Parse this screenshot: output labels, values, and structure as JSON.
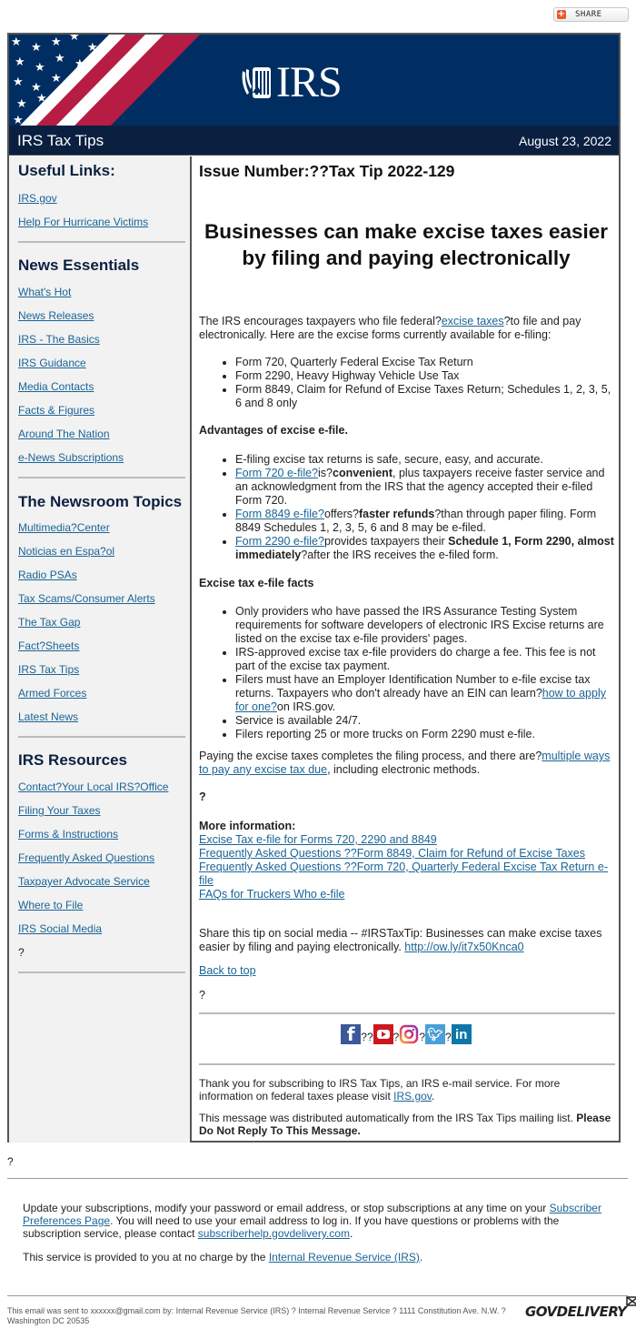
{
  "share": {
    "label": "SHARE"
  },
  "header": {
    "logo_text": "IRS",
    "title": "IRS Tax Tips",
    "date": "August 23, 2022"
  },
  "colors": {
    "banner": "#002e62",
    "titlebar": "#0b2040",
    "link": "#1a6496",
    "flag_red": "#b71c45"
  },
  "sidebar": {
    "sections": [
      {
        "heading": "Useful Links:",
        "links": [
          "IRS.gov",
          "Help For Hurricane Victims"
        ]
      },
      {
        "heading": "News Essentials",
        "links": [
          "What's Hot",
          "News Releases",
          "IRS - The Basics",
          "IRS Guidance",
          "Media Contacts",
          "Facts & Figures",
          "Around The Nation",
          "e-News Subscriptions"
        ]
      },
      {
        "heading": "The Newsroom Topics",
        "links": [
          "Multimedia?Center",
          "Noticias en Espa?ol",
          "Radio PSAs",
          "Tax Scams/Consumer Alerts",
          "The Tax Gap",
          "Fact?Sheets",
          "IRS Tax Tips",
          "Armed Forces",
          "Latest News"
        ]
      },
      {
        "heading": "IRS Resources",
        "links": [
          "Contact?Your Local IRS?Office",
          "Filing Your Taxes",
          "Forms & Instructions",
          "Frequently Asked Questions",
          "Taxpayer Advocate Service",
          "Where to File",
          "IRS Social Media"
        ],
        "trailing": "?"
      }
    ]
  },
  "main": {
    "issue": "Issue Number:??Tax Tip 2022-129",
    "headline": "Businesses can make excise taxes easier by filing and paying electronically",
    "intro": {
      "before": "The IRS encourages taxpayers who file federal?",
      "link": "excise taxes",
      "after": "?to file and pay electronically. Here are the excise forms currently available for e-filing:"
    },
    "forms": [
      "Form 720, Quarterly Federal Excise Tax Return",
      "Form 2290, Heavy Highway Vehicle Use Tax",
      "Form 8849, Claim for Refund of Excise Taxes Return; Schedules 1, 2, 3, 5, 6 and 8 only"
    ],
    "advantages_heading": "Advantages of excise e-file.",
    "advantages": {
      "a0": "E-filing excise tax returns is safe, secure, easy, and accurate.",
      "a1": {
        "link": "Form 720 e-file?",
        "t1": "is?",
        "bold": "convenient",
        "t2": ", plus taxpayers receive faster service and an acknowledgment from the IRS that the agency accepted their e-filed Form 720."
      },
      "a2": {
        "link": "Form 8849 e-file?",
        "t1": "offers?",
        "bold": "faster refunds",
        "t2": "?than through paper filing. Form 8849 Schedules 1, 2, 3, 5, 6 and 8 may be e-filed."
      },
      "a3": {
        "link": "Form 2290 e-file?",
        "t1": "provides taxpayers their ",
        "bold": "Schedule 1, Form 2290, almost immediately",
        "t2": "?after the IRS receives the e-filed form."
      }
    },
    "facts_heading": "Excise tax e-file facts",
    "facts": {
      "f0": "Only providers who have passed the IRS Assurance Testing System requirements for software developers of electronic IRS Excise returns are listed on the excise tax e-file providers' pages.",
      "f1": "IRS-approved excise tax e-file providers do charge a fee. This fee is not part of the excise tax payment.",
      "f2": {
        "before": "Filers must have an Employer Identification Number to e-file excise tax returns. Taxpayers who don't already have an EIN can learn?",
        "link": "how to apply for one?",
        "after": "on IRS.gov."
      },
      "f3": "Service is available 24/7.",
      "f4": "Filers reporting 25 or more trucks on Form 2290 must e-file."
    },
    "paying": {
      "before": "Paying the excise taxes completes the filing process, and there are?",
      "link": "multiple ways to pay any excise tax due",
      "after": ", including electronic methods."
    },
    "q1": "?",
    "more_heading": "More information:",
    "more_links": [
      "Excise Tax e-file for Forms 720, 2290 and 8849",
      "Frequently Asked Questions ??Form 8849, Claim for Refund of Excise Taxes",
      "Frequently Asked Questions ??Form 720, Quarterly Federal Excise Tax Return e-file",
      "FAQs for Truckers Who e-file"
    ],
    "share_tip": {
      "text": "Share this tip on social media -- #IRSTaxTip: Businesses can make excise taxes easier by filing and paying electronically. ",
      "link": "http://ow.ly/it7x50Knca0"
    },
    "back_to_top": "Back to top",
    "q2": "?",
    "social": {
      "sep1": "??",
      "sep2": "?",
      "sep3": "?",
      "sep4": "?",
      "icons": [
        "facebook",
        "youtube",
        "instagram",
        "twitter",
        "linkedin"
      ]
    },
    "thanks": {
      "before": "Thank you for subscribing to IRS Tax Tips, an IRS e-mail service. For more information on federal taxes please visit ",
      "link": "IRS.gov",
      "after": "."
    },
    "distributed": {
      "text": "This message was distributed automatically from the IRS Tax Tips mailing list. ",
      "bold": "Please Do Not Reply To This Message."
    }
  },
  "footer": {
    "q": "?",
    "prefs": {
      "t1": "Update your subscriptions, modify your password or email address, or stop subscriptions at any time on your ",
      "link1": "Subscriber Preferences Page",
      "t2": ". You will need to use your email address to log in. If you have questions or problems with the subscription service, please contact ",
      "link2": "subscriberhelp.govdelivery.com",
      "t3": "."
    },
    "service": {
      "t1": "This service is provided to you at no charge by the ",
      "link": "Internal Revenue Service (IRS)",
      "t2": "."
    },
    "sent_to": "This email was sent to xxxxxx@gmail.com by: Internal Revenue Service (IRS) ? Internal Revenue Service ? 1111 Constitution Ave. N.W. ? Washington DC 20535",
    "brand": "GOVDELIVERY"
  }
}
